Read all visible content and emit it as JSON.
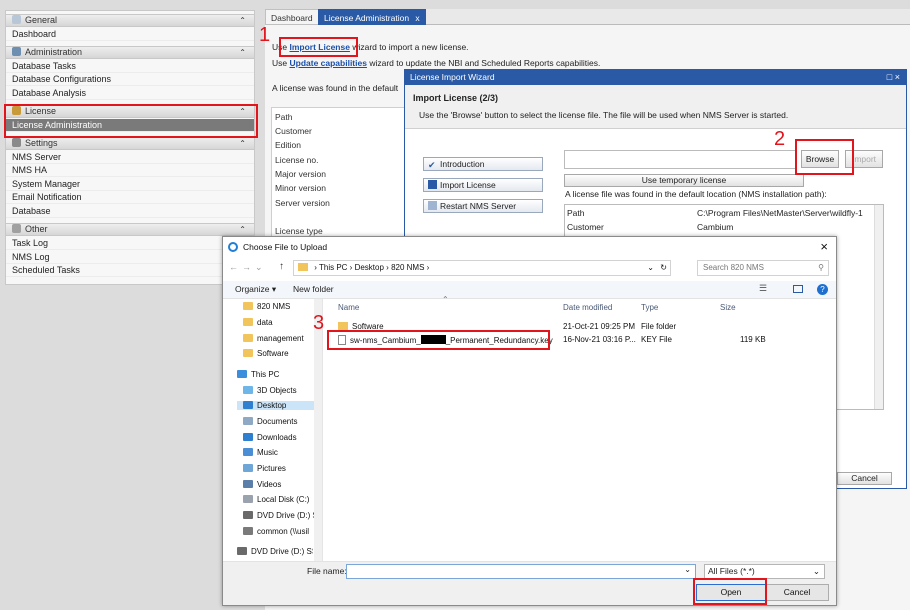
{
  "sidebar": {
    "general": {
      "title": "General",
      "items": [
        "Dashboard"
      ]
    },
    "administration": {
      "title": "Administration",
      "items": [
        "Database Tasks",
        "Database Configurations",
        "Database Analysis"
      ]
    },
    "license": {
      "title": "License",
      "items": [
        "License Administration"
      ]
    },
    "settings": {
      "title": "Settings",
      "items": [
        "NMS Server",
        "NMS HA",
        "System Manager",
        "Email Notification",
        "Database"
      ]
    },
    "other": {
      "title": "Other",
      "items": [
        "Task Log",
        "NMS Log",
        "Scheduled Tasks"
      ]
    }
  },
  "tabs": [
    {
      "label": "Dashboard"
    },
    {
      "label": "License Administration"
    }
  ],
  "tab_close": "x",
  "main": {
    "line1_pre": "Use ",
    "line1_link": "Import License",
    "line1_post": " wizard to import a new license.",
    "line2_pre": "Use ",
    "line2_link": "Update capabilities",
    "line2_post": " wizard to update the NBI and Scheduled Reports capabilities.",
    "line3": "A license was found in the default",
    "info_labels": [
      "Path",
      "Customer",
      "Edition",
      "License no.",
      "Major version",
      "Minor version",
      "Server version",
      "License type"
    ]
  },
  "wizard": {
    "title": "License Import Wizard",
    "window_buttons": "□ ×",
    "step": "Import License (2/3)",
    "instruction": "Use the 'Browse' button to select the license file. The file will be used when NMS Server is started.",
    "nav": [
      "Introduction",
      "Import License",
      "Restart NMS Server"
    ],
    "browse": "Browse",
    "import": "Import",
    "use_temp": "Use temporary license",
    "found_text": "A license file was found in the default location (NMS installation path):",
    "info_rows": [
      {
        "label": "Path",
        "value": "C:\\Program Files\\NetMaster\\Server\\wildfly-1"
      },
      {
        "label": "Customer",
        "value": "Cambium"
      }
    ],
    "cancel": "Cancel"
  },
  "dialog": {
    "title": "Choose File to Upload",
    "close": "×",
    "breadcrumb": [
      "This PC",
      "Desktop",
      "820 NMS"
    ],
    "search_placeholder": "Search 820 NMS",
    "organize": "Organize ▾",
    "new_folder": "New folder",
    "tree": [
      "820 NMS",
      "data",
      "management",
      "Software",
      "This PC",
      "3D Objects",
      "Desktop",
      "Documents",
      "Downloads",
      "Music",
      "Pictures",
      "Videos",
      "Local Disk (C:)",
      "DVD Drive (D:) SS",
      "common (\\\\usil",
      "DVD Drive (D:) SSS"
    ],
    "columns": [
      "Name",
      "Date modified",
      "Type",
      "Size"
    ],
    "files": [
      {
        "name": "Software",
        "date": "21-Oct-21 09:25 PM",
        "type": "File folder",
        "size": ""
      },
      {
        "name_a": "sw-nms_Cambium_",
        "name_b": "_Permanent_Redundancy.key",
        "date": "16-Nov-21 03:16 P...",
        "type": "KEY File",
        "size": "119 KB"
      }
    ],
    "filename_label": "File name:",
    "filter": "All Files (*.*)",
    "open": "Open",
    "cancel": "Cancel"
  },
  "annotations": [
    "1",
    "2",
    "3"
  ],
  "colors": {
    "accent": "#2a5aa6",
    "highlight": "#e2141c",
    "selected_item": "#7a7a7a"
  }
}
